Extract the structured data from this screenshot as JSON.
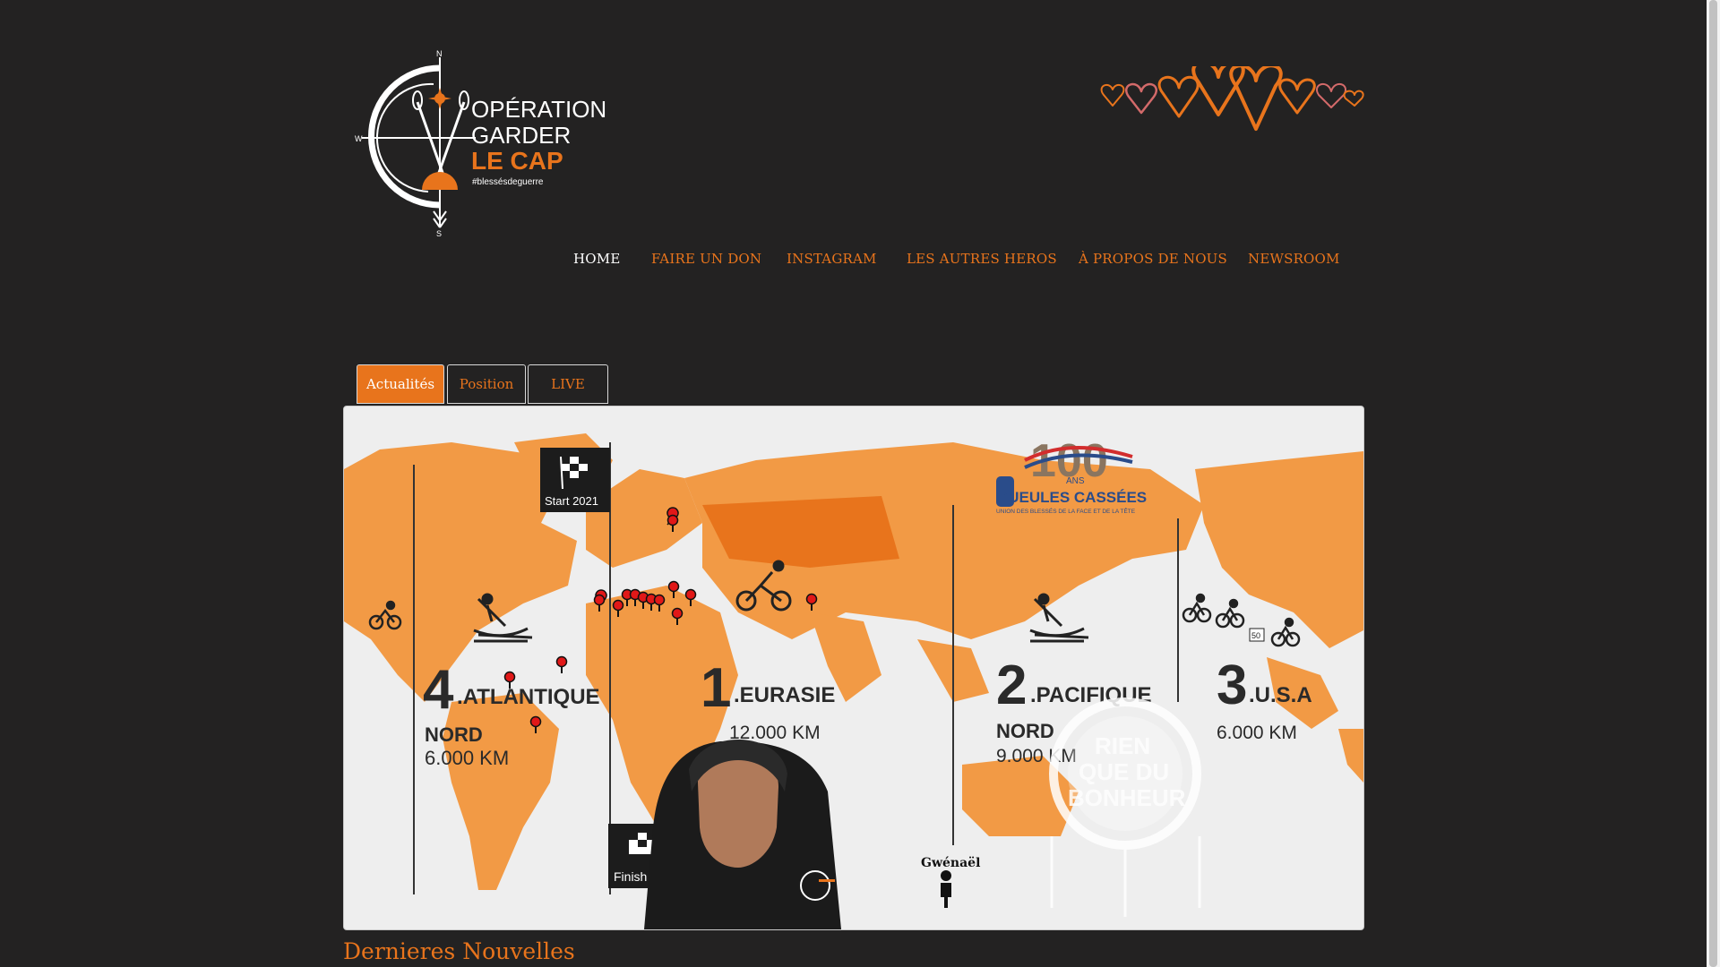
{
  "header": {
    "logo": {
      "line1": "OPÉRATION",
      "line2": "GARDER",
      "line3": "LE CAP",
      "hashtag": "#blessésdeguerre",
      "compass": {
        "n": "N",
        "w": "W",
        "s": "S"
      }
    },
    "hearts_icon": "hearts-garland-icon"
  },
  "nav": {
    "items": [
      {
        "label": "HOME",
        "active": true
      },
      {
        "label": "FAIRE UN DON"
      },
      {
        "label": "INSTAGRAM"
      },
      {
        "label": "LES AUTRES HEROS"
      },
      {
        "label": "À PROPOS DE NOUS"
      },
      {
        "label": "NEWSROOM"
      }
    ]
  },
  "tabs": [
    {
      "label": "Actualités",
      "active": true
    },
    {
      "label": "Position"
    },
    {
      "label": "LIVE"
    }
  ],
  "map": {
    "start_label": "Start 2021",
    "finish_label": "Finish ?",
    "gueules": {
      "number": "100",
      "ans": "ANS",
      "name": "GUEULES CASSÉES",
      "sub": "UNION DES BLESSÉS DE LA FACE ET DE LA TÊTE"
    },
    "legs": [
      {
        "num": "4",
        "name": ".ATLANTIQUE",
        "line2": "NORD",
        "dist": "6.000 KM"
      },
      {
        "num": "1",
        "name": ".EURASIE",
        "line2": "",
        "dist": "12.000 KM"
      },
      {
        "num": "2",
        "name": ".PACIFIQUE",
        "line2": "NORD",
        "dist": "9.000 KM"
      },
      {
        "num": "3",
        "name": ".U.S.A",
        "line2": "",
        "dist": "6.000 KM"
      }
    ],
    "badge": {
      "l1": "RIEN",
      "l2": "QUE DU",
      "l3": "BONHEUR"
    },
    "person_name": "Gwénaël",
    "speed_sign": "50",
    "colors": {
      "land": "#f29a45",
      "land_dark": "#e8741c",
      "ocean": "#eeeeee",
      "pin": "#e11818"
    }
  },
  "section": {
    "title": "Dernieres Nouvelles"
  },
  "theme": {
    "accent": "#e8741c",
    "background": "#232222"
  }
}
